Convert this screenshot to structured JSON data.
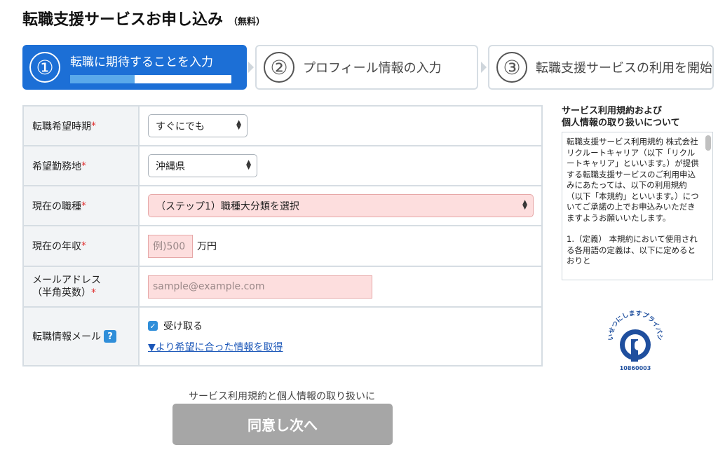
{
  "header": {
    "title": "転職支援サービスお申し込み",
    "free_label": "（無料）"
  },
  "steps": [
    {
      "number": "①",
      "label": "転職に期待することを入力",
      "active": true,
      "progress_percent": 40
    },
    {
      "number": "②",
      "label": "プロフィール情報の入力",
      "active": false
    },
    {
      "number": "③",
      "label": "転職支援サービスの利用を開始",
      "active": false
    }
  ],
  "form": {
    "timing": {
      "label": "転職希望時期",
      "required_mark": "*",
      "value": "すぐにでも"
    },
    "location": {
      "label": "希望勤務地",
      "required_mark": "*",
      "value": "沖縄県"
    },
    "occupation": {
      "label": "現在の職種",
      "required_mark": "*",
      "value": "（ステップ1）職種大分類を選択"
    },
    "income": {
      "label": "現在の年収",
      "required_mark": "*",
      "placeholder": "例)500",
      "unit": "万円"
    },
    "email": {
      "label_line1": "メールアドレス",
      "label_line2": "（半角英数）",
      "required_mark": "*",
      "placeholder": "sample@example.com"
    },
    "newsletter": {
      "label": "転職情報メール",
      "help_icon": "?",
      "checkbox_label": "受け取る",
      "checked": true,
      "link_text": "▼より希望に合った情報を取得"
    }
  },
  "terms": {
    "title_line1": "サービス利用規約および",
    "title_line2": "個人情報の取り扱いについて",
    "para1": "転職支援サービス利用規約 株式会社リクルートキャリア（以下「リクルートキャリア」といいます。）が提供する転職支援サービスのご利用申込みにあたっては、以下の利用規約（以下「本規約」といいます。）についてご承諾の上でお申込みいただきますようお願いいたします。",
    "para2": "1.（定義） 本規約において使用される各用語の定義は、以下に定めるとおりと"
  },
  "privacy_mark": {
    "arc_text": "たいせつにしますプライバシー",
    "number": "10860003"
  },
  "footer": {
    "agree_text": "サービス利用規約と個人情報の取り扱いに",
    "next_button": "同意し次へ"
  },
  "colors": {
    "primary": "#1c6fd6",
    "required": "#e03030",
    "error_bg": "#fddede",
    "disabled_button": "#a6a6a6",
    "link": "#1a56b8"
  }
}
